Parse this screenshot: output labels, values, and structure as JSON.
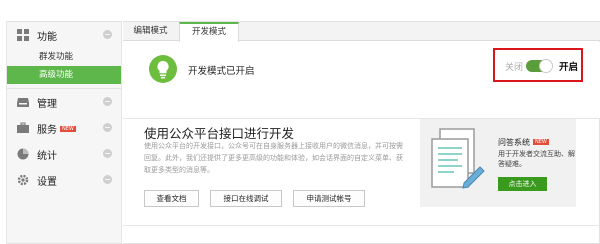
{
  "sidebar": {
    "sections": [
      {
        "label": "功能",
        "icon": "grid-icon"
      },
      {
        "label": "管理",
        "icon": "inbox-icon"
      },
      {
        "label": "服务",
        "icon": "briefcase-icon",
        "badge": "NEW"
      },
      {
        "label": "统计",
        "icon": "pie-chart-icon"
      },
      {
        "label": "设置",
        "icon": "gear-icon"
      }
    ],
    "sub_items": [
      {
        "label": "群发功能",
        "active": false
      },
      {
        "label": "高级功能",
        "active": true
      }
    ]
  },
  "tabs": [
    {
      "label": "编辑模式",
      "active": false
    },
    {
      "label": "开发模式",
      "active": true
    }
  ],
  "status": {
    "text": "开发模式已开启",
    "toggle_off_label": "关闭",
    "toggle_on_label": "开启",
    "toggle_state": "on"
  },
  "dev": {
    "title": "使用公众平台接口进行开发",
    "description": "使用公众平台的开发接口，公众号可在自身服务器上接收用户的微信消息，并可按需回复。此外，我们还提供了更多更高级的功能和体验，如会话界面的自定义菜单、获取更多类型的消息等。",
    "buttons": [
      "查看文档",
      "接口在线调试",
      "申请测试帐号"
    ]
  },
  "card": {
    "title": "问答系统",
    "badge": "NEW",
    "description": "用于开发者交流互助、解答疑难。",
    "button": "点击进入"
  },
  "colors": {
    "accent": "#5eb74a",
    "button_green": "#3a9a1e",
    "highlight_border": "#d9161a",
    "badge_red": "#e34d3b"
  }
}
